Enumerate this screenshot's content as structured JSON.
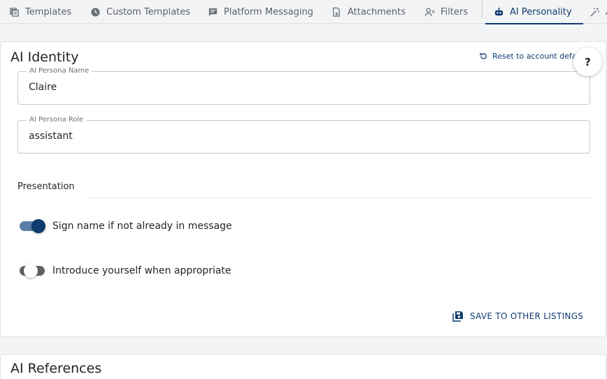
{
  "tabs": [
    {
      "label": "Templates",
      "icon": "template-icon",
      "active": false
    },
    {
      "label": "Custom Templates",
      "icon": "custom-template-icon",
      "active": false
    },
    {
      "label": "Platform Messaging",
      "icon": "message-icon",
      "active": false
    },
    {
      "label": "Attachments",
      "icon": "attachment-icon",
      "active": false
    },
    {
      "label": "Filters",
      "icon": "filter-icon",
      "active": false
    },
    {
      "label": "AI Personality",
      "icon": "robot-icon",
      "active": true
    },
    {
      "label": "A",
      "icon": "magic-wand-icon",
      "active": false
    }
  ],
  "identity": {
    "title": "AI Identity",
    "reset_label": "Reset to account defa",
    "help_label": "?",
    "persona_name": {
      "label": "AI Persona Name",
      "value": "Claire"
    },
    "persona_role": {
      "label": "AI Persona Role",
      "value": "assistant"
    },
    "presentation": {
      "title": "Presentation",
      "toggles": [
        {
          "label": "Sign name if not already in message",
          "on": true
        },
        {
          "label": "Introduce yourself when appropriate",
          "on": false
        }
      ]
    },
    "save_label": "SAVE TO OTHER LISTINGS"
  },
  "references": {
    "title": "AI References"
  },
  "colors": {
    "accent": "#0e3a6e",
    "switch_track_on": "#5a7ea8",
    "switch_track_off": "#5f6368"
  }
}
